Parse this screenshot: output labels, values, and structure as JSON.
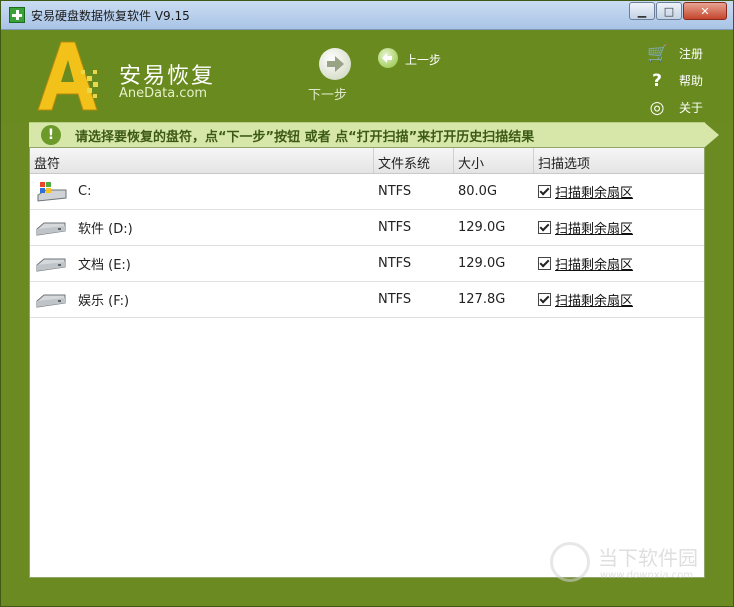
{
  "window": {
    "title": "安易硬盘数据恢复软件 V9.15",
    "min": "▁",
    "max": "□",
    "close": "✕"
  },
  "header": {
    "logo_title": "安易恢复",
    "logo_sub": "AneData.com",
    "next_label": "下一步",
    "prev_label": "上一步",
    "menu": [
      {
        "label": "注册",
        "icon": "cart-icon"
      },
      {
        "label": "帮助",
        "icon": "question-icon"
      },
      {
        "label": "关于",
        "icon": "target-icon"
      }
    ]
  },
  "banner": {
    "icon": "!",
    "text": "请选择要恢复的盘符，点“下一步”按钮 或者 点“打开扫描”来打开历史扫描结果"
  },
  "table": {
    "columns": [
      "盘符",
      "文件系统",
      "大小",
      "扫描选项"
    ],
    "rows": [
      {
        "drive": "C:",
        "fs": "NTFS",
        "size": "80.0G",
        "option": "扫描剩余扇区",
        "type": "system"
      },
      {
        "drive": "软件 (D:)",
        "fs": "NTFS",
        "size": "129.0G",
        "option": "扫描剩余扇区",
        "type": "disk"
      },
      {
        "drive": "文档 (E:)",
        "fs": "NTFS",
        "size": "129.0G",
        "option": "扫描剩余扇区",
        "type": "disk"
      },
      {
        "drive": "娱乐 (F:)",
        "fs": "NTFS",
        "size": "127.8G",
        "option": "扫描剩余扇区",
        "type": "disk"
      }
    ]
  },
  "watermark": {
    "text": "当下软件园",
    "sub": "www.downxia.com"
  }
}
